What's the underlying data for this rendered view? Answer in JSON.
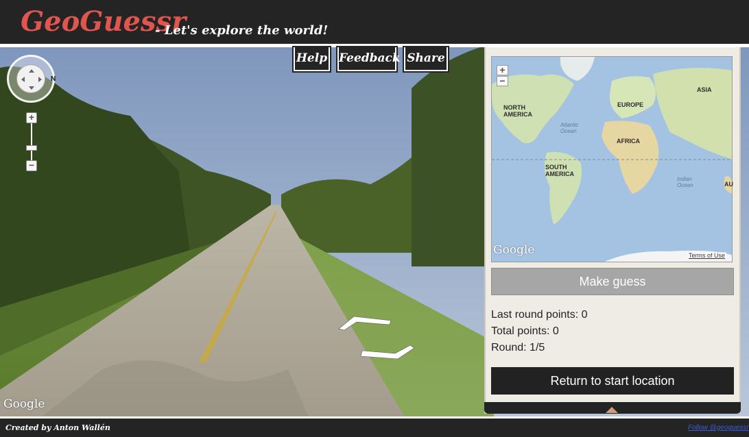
{
  "header": {
    "logo": "GeoGuessr",
    "tagline": "- Let's explore the world!"
  },
  "topnav": {
    "help": "Help",
    "feedback": "Feedback",
    "share": "Share"
  },
  "streetview": {
    "north_label": "N",
    "zoom_in": "+",
    "zoom_out": "−",
    "google_logo": "Google",
    "icons": [
      "compass-icon",
      "zoom-in-icon",
      "zoom-out-icon",
      "nav-arrow-forward-icon",
      "nav-arrow-back-icon"
    ]
  },
  "minimap": {
    "zoom_in": "+",
    "zoom_out": "−",
    "google_logo": "Google",
    "terms": "Terms of Use",
    "labels": {
      "north_america": "NORTH AMERICA",
      "south_america": "SOUTH AMERICA",
      "europe": "EUROPE",
      "asia": "ASIA",
      "africa": "AFRICA",
      "au": "AU",
      "atlantic": "Atlantic Ocean",
      "indian": "Indian Ocean"
    }
  },
  "panel": {
    "make_guess": "Make guess",
    "last_round_points": "Last round points: 0",
    "total_points": "Total points: 0",
    "round": "Round: 1/5",
    "return_button": "Return to start location"
  },
  "footer": {
    "credit": "Created by Anton Wallén",
    "follow": "Follow @geoguessr"
  },
  "colors": {
    "header_bg": "#242424",
    "logo": "#e0554d",
    "guess_button": "#a6a6a6",
    "panel_bg": "#efece6",
    "ocean": "#a4c3e3",
    "land": "#cfe1b2"
  }
}
